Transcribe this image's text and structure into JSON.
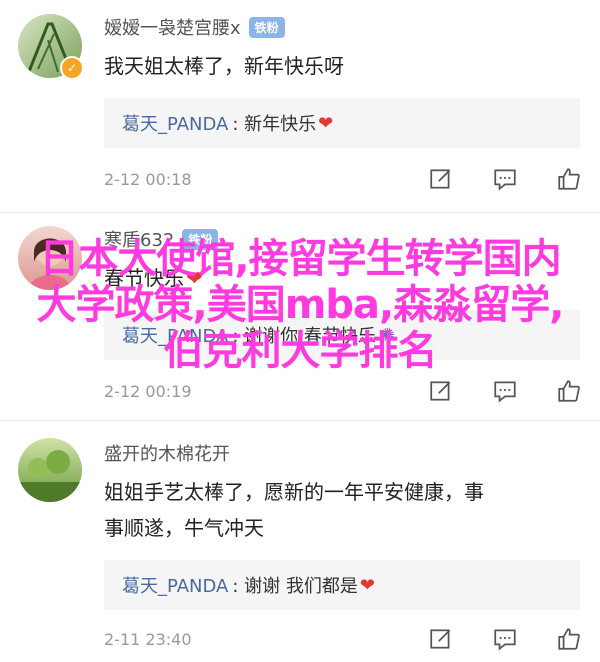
{
  "comments": [
    {
      "username": "嫒嫒一袅楚宫腰x",
      "badge": "铁粉",
      "text": "我天姐太棒了，新年快乐呀",
      "reply_user": "葛天_PANDA",
      "reply_text": ": 新年快乐",
      "timestamp": "2-12 00:18"
    },
    {
      "username": "寒盾632",
      "badge": "铁粉",
      "text": "春节快乐",
      "reply_user": "葛天_PANDA",
      "reply_text": ": 谢谢你 春节快乐",
      "timestamp": "2-12 00:19"
    },
    {
      "username": "盛开的木棉花开",
      "text_line1": "姐姐手艺太棒了，愿新的一年平安健康，事",
      "text_line2": "事顺遂，牛气冲天",
      "reply_user": "葛天_PANDA",
      "reply_text": ": 谢谢 我们都是",
      "timestamp": "2-11 23:40"
    }
  ],
  "overlay_text": "日本大使馆,接留学生转学国内大学政策,美国mba,森淼留学,伯克利大学排名",
  "colors": {
    "overlay": "#ff3be0",
    "reply_user": "#4a6a9c",
    "heart": "#e53935",
    "badge": "#8bb4e8"
  },
  "icons": [
    "edit-icon",
    "comment-icon",
    "thumbs-up-icon",
    "heart-icon",
    "verified-icon"
  ]
}
